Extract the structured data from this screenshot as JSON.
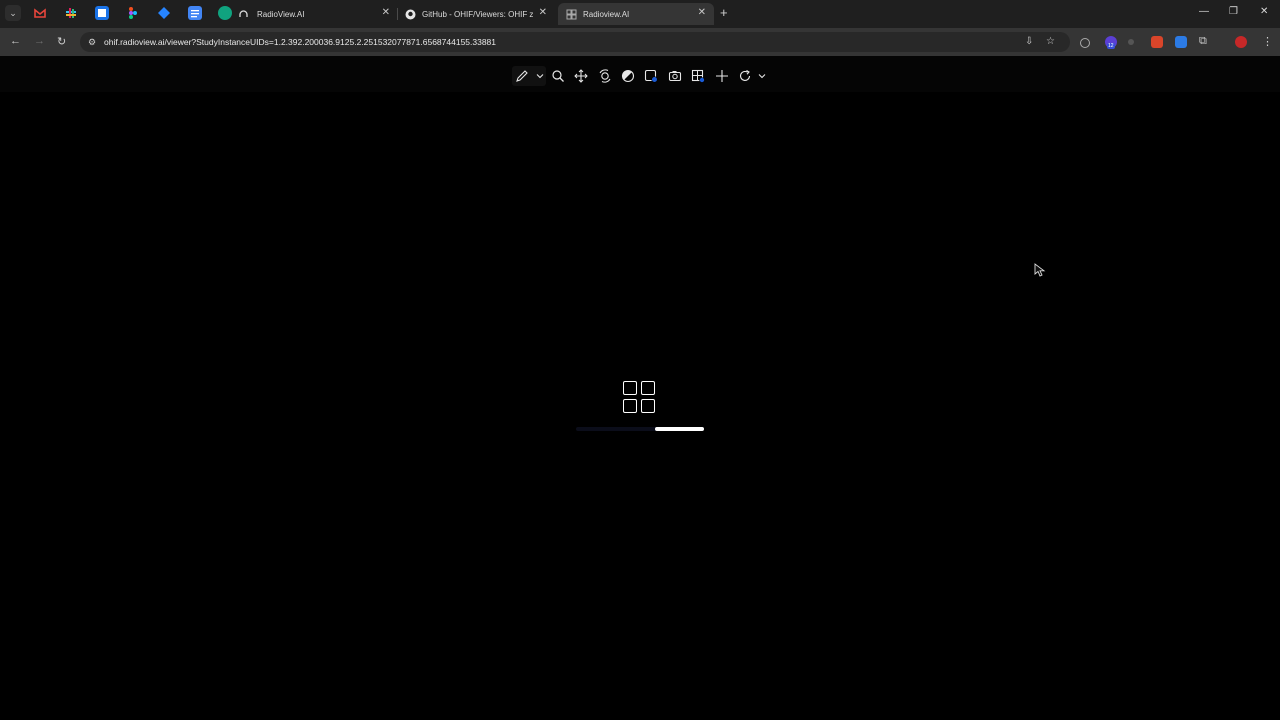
{
  "tabs": [
    {
      "title": "RadioView.AI",
      "active": false
    },
    {
      "title": "GitHub - OHIF/Viewers: OHIF z",
      "active": false
    },
    {
      "title": "Radioview.AI",
      "active": true
    }
  ],
  "pinned_tabs": [
    "gmail-icon",
    "slack-icon",
    "calendar-icon",
    "figma-icon",
    "jira-icon",
    "docs-icon",
    "extension-icon"
  ],
  "address_bar": {
    "url": "ohif.radioview.ai/viewer?StudyInstanceUIDs=1.2.392.200036.9125.2.251532077871.6568744155.33881"
  },
  "extensions": {
    "badge_count": "12"
  },
  "viewer_toolbar": {
    "tools": [
      "pencil-icon",
      "zoom-icon",
      "pan-icon",
      "window-level-icon",
      "contrast-icon",
      "capture-icon",
      "camera-icon",
      "layout-icon",
      "crosshair-icon",
      "rotate-icon"
    ]
  },
  "loading": {
    "progress": 0.38
  },
  "colors": {
    "background": "#000000",
    "tabstrip": "#1f1f1f",
    "toolbar": "#353535",
    "accent": "#ffffff"
  }
}
